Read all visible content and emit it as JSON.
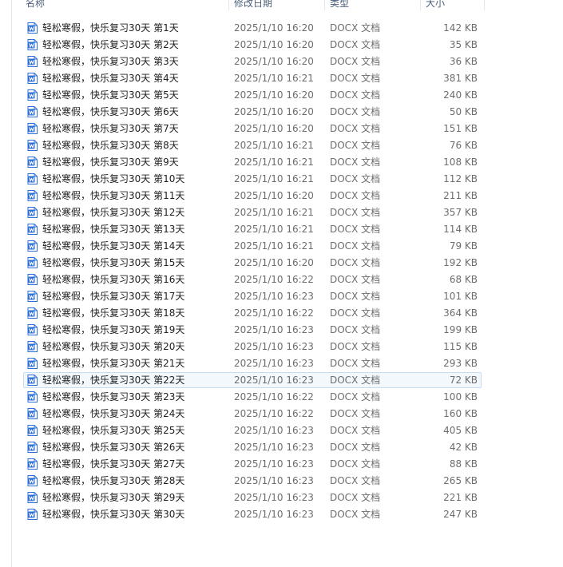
{
  "columns": {
    "name": "名称",
    "date": "修改日期",
    "type": "类型",
    "size": "大小"
  },
  "colors": {
    "icon_blue": "#2b6fd6",
    "selected_bg": "#f3f8fd",
    "selected_border": "#c6dcf2"
  },
  "files": [
    {
      "name": "轻松寒假，快乐复习30天 第1天",
      "date": "2025/1/10 16:20",
      "type": "DOCX 文档",
      "size": "142 KB"
    },
    {
      "name": "轻松寒假，快乐复习30天 第2天",
      "date": "2025/1/10 16:20",
      "type": "DOCX 文档",
      "size": "35 KB"
    },
    {
      "name": "轻松寒假，快乐复习30天 第3天",
      "date": "2025/1/10 16:20",
      "type": "DOCX 文档",
      "size": "36 KB"
    },
    {
      "name": "轻松寒假，快乐复习30天 第4天",
      "date": "2025/1/10 16:21",
      "type": "DOCX 文档",
      "size": "381 KB"
    },
    {
      "name": "轻松寒假，快乐复习30天 第5天",
      "date": "2025/1/10 16:20",
      "type": "DOCX 文档",
      "size": "240 KB"
    },
    {
      "name": "轻松寒假，快乐复习30天 第6天",
      "date": "2025/1/10 16:20",
      "type": "DOCX 文档",
      "size": "50 KB"
    },
    {
      "name": "轻松寒假，快乐复习30天 第7天",
      "date": "2025/1/10 16:20",
      "type": "DOCX 文档",
      "size": "151 KB"
    },
    {
      "name": "轻松寒假，快乐复习30天 第8天",
      "date": "2025/1/10 16:21",
      "type": "DOCX 文档",
      "size": "76 KB"
    },
    {
      "name": "轻松寒假，快乐复习30天 第9天",
      "date": "2025/1/10 16:21",
      "type": "DOCX 文档",
      "size": "108 KB"
    },
    {
      "name": "轻松寒假，快乐复习30天 第10天",
      "date": "2025/1/10 16:21",
      "type": "DOCX 文档",
      "size": "112 KB"
    },
    {
      "name": "轻松寒假，快乐复习30天 第11天",
      "date": "2025/1/10 16:20",
      "type": "DOCX 文档",
      "size": "211 KB"
    },
    {
      "name": "轻松寒假，快乐复习30天 第12天",
      "date": "2025/1/10 16:21",
      "type": "DOCX 文档",
      "size": "357 KB"
    },
    {
      "name": "轻松寒假，快乐复习30天 第13天",
      "date": "2025/1/10 16:21",
      "type": "DOCX 文档",
      "size": "114 KB"
    },
    {
      "name": "轻松寒假，快乐复习30天 第14天",
      "date": "2025/1/10 16:21",
      "type": "DOCX 文档",
      "size": "79 KB"
    },
    {
      "name": "轻松寒假，快乐复习30天 第15天",
      "date": "2025/1/10 16:20",
      "type": "DOCX 文档",
      "size": "192 KB"
    },
    {
      "name": "轻松寒假，快乐复习30天 第16天",
      "date": "2025/1/10 16:22",
      "type": "DOCX 文档",
      "size": "68 KB"
    },
    {
      "name": "轻松寒假，快乐复习30天 第17天",
      "date": "2025/1/10 16:23",
      "type": "DOCX 文档",
      "size": "101 KB"
    },
    {
      "name": "轻松寒假，快乐复习30天 第18天",
      "date": "2025/1/10 16:22",
      "type": "DOCX 文档",
      "size": "364 KB"
    },
    {
      "name": "轻松寒假，快乐复习30天 第19天",
      "date": "2025/1/10 16:23",
      "type": "DOCX 文档",
      "size": "199 KB"
    },
    {
      "name": "轻松寒假，快乐复习30天 第20天",
      "date": "2025/1/10 16:23",
      "type": "DOCX 文档",
      "size": "115 KB"
    },
    {
      "name": "轻松寒假，快乐复习30天 第21天",
      "date": "2025/1/10 16:23",
      "type": "DOCX 文档",
      "size": "293 KB"
    },
    {
      "name": "轻松寒假，快乐复习30天 第22天",
      "date": "2025/1/10 16:23",
      "type": "DOCX 文档",
      "size": "72 KB",
      "selected": true
    },
    {
      "name": "轻松寒假，快乐复习30天 第23天",
      "date": "2025/1/10 16:22",
      "type": "DOCX 文档",
      "size": "100 KB"
    },
    {
      "name": "轻松寒假，快乐复习30天 第24天",
      "date": "2025/1/10 16:22",
      "type": "DOCX 文档",
      "size": "160 KB"
    },
    {
      "name": "轻松寒假，快乐复习30天 第25天",
      "date": "2025/1/10 16:23",
      "type": "DOCX 文档",
      "size": "405 KB"
    },
    {
      "name": "轻松寒假，快乐复习30天 第26天",
      "date": "2025/1/10 16:23",
      "type": "DOCX 文档",
      "size": "42 KB"
    },
    {
      "name": "轻松寒假，快乐复习30天 第27天",
      "date": "2025/1/10 16:23",
      "type": "DOCX 文档",
      "size": "88 KB"
    },
    {
      "name": "轻松寒假，快乐复习30天 第28天",
      "date": "2025/1/10 16:23",
      "type": "DOCX 文档",
      "size": "265 KB"
    },
    {
      "name": "轻松寒假，快乐复习30天 第29天",
      "date": "2025/1/10 16:23",
      "type": "DOCX 文档",
      "size": "221 KB"
    },
    {
      "name": "轻松寒假，快乐复习30天 第30天",
      "date": "2025/1/10 16:23",
      "type": "DOCX 文档",
      "size": "247 KB"
    }
  ]
}
